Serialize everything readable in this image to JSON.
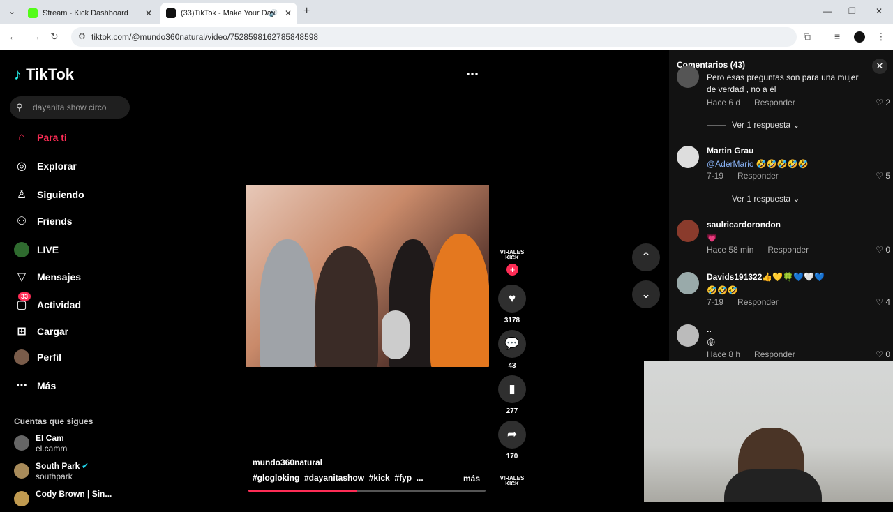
{
  "browser": {
    "tabs": [
      {
        "title": "Stream - Kick Dashboard",
        "favicon_color": "#53fc18"
      },
      {
        "title": "(33)TikTok - Make Your Day",
        "favicon_color": "#111111"
      }
    ],
    "url": "tiktok.com/@mundo360natural/video/7528598162785848598"
  },
  "sidebar": {
    "logo": "TikTok",
    "search_placeholder": "dayanita show circo",
    "nav": [
      {
        "label": "Para ti",
        "icon": "home-icon"
      },
      {
        "label": "Explorar",
        "icon": "compass-icon"
      },
      {
        "label": "Siguiendo",
        "icon": "following-icon"
      },
      {
        "label": "Friends",
        "icon": "friends-icon"
      },
      {
        "label": "LIVE",
        "icon": "live-icon"
      },
      {
        "label": "Mensajes",
        "icon": "messages-icon"
      },
      {
        "label": "Actividad",
        "icon": "activity-icon",
        "badge": "33"
      },
      {
        "label": "Cargar",
        "icon": "upload-icon"
      },
      {
        "label": "Perfil",
        "icon": "profile-icon"
      },
      {
        "label": "Más",
        "icon": "more-icon"
      }
    ],
    "following_header": "Cuentas que sigues",
    "following": [
      {
        "name": "El Cam",
        "handle": "el.camm"
      },
      {
        "name": "South Park",
        "handle": "southpark"
      },
      {
        "name": "Cody Brown | Sin...",
        "handle": ""
      }
    ]
  },
  "video": {
    "author": "mundo360natural",
    "hashtags": "#glogloking  #dayanitashow  #kick  #fyp  ...",
    "more": "más",
    "creator_badge": "VIRALES KICK",
    "progress": 0.46,
    "counts": {
      "likes": "3178",
      "comments": "43",
      "saves": "277",
      "shares": "170"
    }
  },
  "comments": {
    "title": "Comentarios (43)",
    "items": [
      {
        "user": "",
        "text": "Pero esas preguntas son para una mujer de verdad , no a él",
        "time": "Hace 6 d",
        "reply": "Responder",
        "likes": "2",
        "view_replies": "Ver 1 respuesta"
      },
      {
        "user": "Martin Grau",
        "mention": "@AderMario",
        "text": "🤣🤣🤣🤣🤣",
        "time": "7-19",
        "reply": "Responder",
        "likes": "5",
        "view_replies": "Ver 1 respuesta"
      },
      {
        "user": "saulricardorondon",
        "text": "💗",
        "time": "Hace 58 min",
        "reply": "Responder",
        "likes": "0"
      },
      {
        "user": "Davids191322",
        "user_emoji": "👍💛🍀💙🤍💙",
        "text": "🤣🤣🤣",
        "time": "7-19",
        "reply": "Responder",
        "likes": "4"
      },
      {
        "user": "..",
        "text": "😝",
        "time": "Hace 8 h",
        "reply": "Responder",
        "likes": "0"
      }
    ]
  }
}
